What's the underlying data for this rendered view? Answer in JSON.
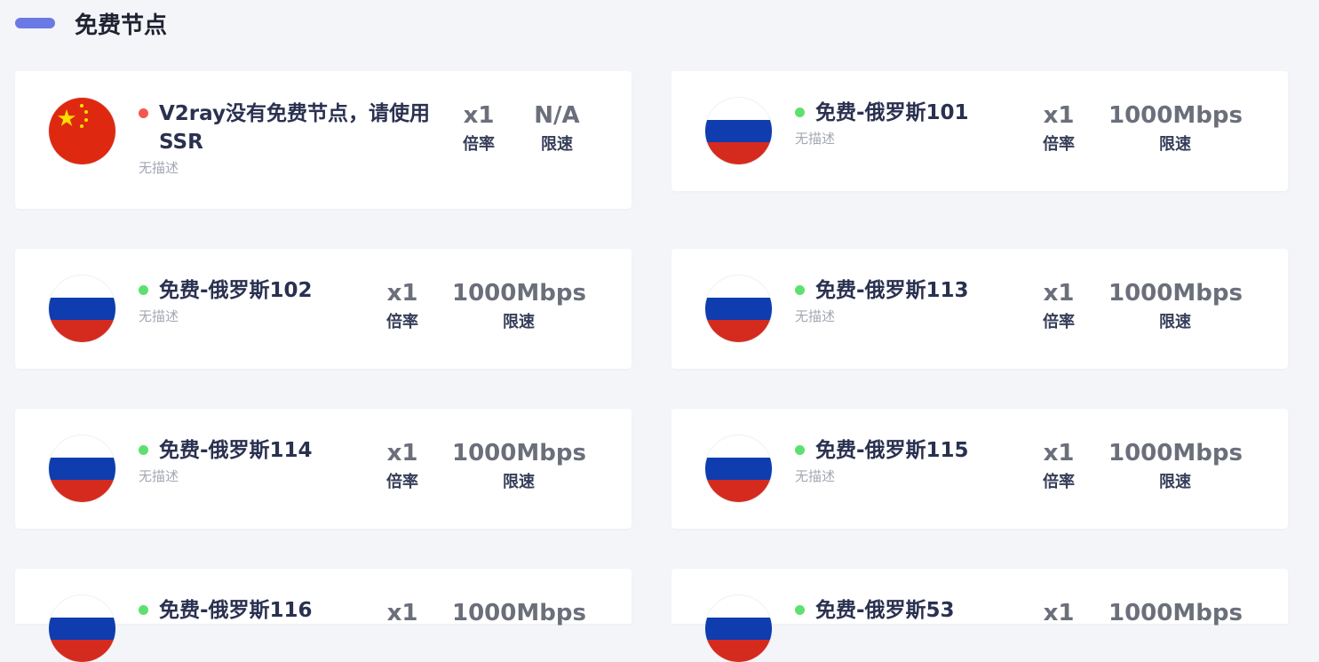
{
  "section": {
    "title": "免费节点"
  },
  "nodes": [
    {
      "flag": "cn-flag",
      "status": "offline",
      "name": "V2ray没有免费节点，请使用SSR",
      "desc": "无描述",
      "rate_value": "x1",
      "rate_label": "倍率",
      "speed_value": "N/A",
      "speed_label": "限速"
    },
    {
      "flag": "ru-flag",
      "status": "online",
      "name": "免费-俄罗斯101",
      "desc": "无描述",
      "rate_value": "x1",
      "rate_label": "倍率",
      "speed_value": "1000Mbps",
      "speed_label": "限速"
    },
    {
      "flag": "ru-flag",
      "status": "online",
      "name": "免费-俄罗斯102",
      "desc": "无描述",
      "rate_value": "x1",
      "rate_label": "倍率",
      "speed_value": "1000Mbps",
      "speed_label": "限速"
    },
    {
      "flag": "ru-flag",
      "status": "online",
      "name": "免费-俄罗斯113",
      "desc": "无描述",
      "rate_value": "x1",
      "rate_label": "倍率",
      "speed_value": "1000Mbps",
      "speed_label": "限速"
    },
    {
      "flag": "ru-flag",
      "status": "online",
      "name": "免费-俄罗斯114",
      "desc": "无描述",
      "rate_value": "x1",
      "rate_label": "倍率",
      "speed_value": "1000Mbps",
      "speed_label": "限速"
    },
    {
      "flag": "ru-flag",
      "status": "online",
      "name": "免费-俄罗斯115",
      "desc": "无描述",
      "rate_value": "x1",
      "rate_label": "倍率",
      "speed_value": "1000Mbps",
      "speed_label": "限速"
    },
    {
      "flag": "ru-flag",
      "status": "online",
      "name": "免费-俄罗斯116",
      "desc": "",
      "rate_value": "x1",
      "rate_label": "",
      "speed_value": "1000Mbps",
      "speed_label": ""
    },
    {
      "flag": "ru-flag",
      "status": "online",
      "name": "免费-俄罗斯53",
      "desc": "",
      "rate_value": "x1",
      "rate_label": "",
      "speed_value": "1000Mbps",
      "speed_label": ""
    }
  ],
  "colors": {
    "accent": "#6b79e4",
    "online": "#5ee06e",
    "offline": "#f4584d"
  }
}
